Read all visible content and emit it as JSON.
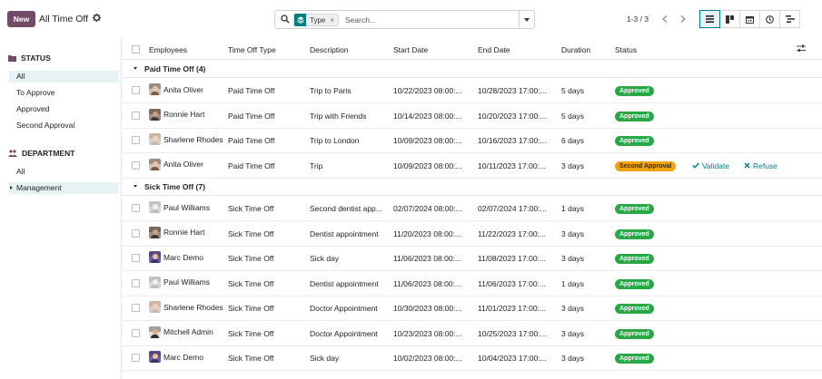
{
  "control_panel": {
    "new_label": "New",
    "title": "All Time Off",
    "search": {
      "facet_label": "Type",
      "facet_remove": "×",
      "placeholder": "Search..."
    },
    "pager": "1-3 / 3"
  },
  "sidebar": {
    "status_heading": "STATUS",
    "status_items": [
      "All",
      "To Approve",
      "Approved",
      "Second Approval"
    ],
    "department_heading": "DEPARTMENT",
    "department_items": [
      "All",
      "Management"
    ]
  },
  "table": {
    "columns": [
      "Employees",
      "Time Off Type",
      "Description",
      "Start Date",
      "End Date",
      "Duration",
      "Status"
    ],
    "groups": [
      {
        "label": "Paid Time Off (4)",
        "rows": [
          {
            "employee": "Anita Oliver",
            "type": "Paid Time Off",
            "description": "Trip to Paris",
            "start": "10/22/2023 08:00:...",
            "end": "10/28/2023 17:00:...",
            "duration": "5 days",
            "status": "Approved"
          },
          {
            "employee": "Ronnie Hart",
            "type": "Paid Time Off",
            "description": "Trip with Friends",
            "start": "10/14/2023 08:00:...",
            "end": "10/20/2023 17:00:...",
            "duration": "5 days",
            "status": "Approved"
          },
          {
            "employee": "Sharlene Rhodes",
            "type": "Paid Time Off",
            "description": "Trip to London",
            "start": "10/09/2023 08:00:...",
            "end": "10/16/2023 17:00:...",
            "duration": "6 days",
            "status": "Approved"
          },
          {
            "employee": "Anita Oliver",
            "type": "Paid Time Off",
            "description": "Trip",
            "start": "10/09/2023 08:00:...",
            "end": "10/11/2023 17:00:...",
            "duration": "3 days",
            "status": "Second Approval",
            "actions": {
              "validate": "Validate",
              "refuse": "Refuse"
            }
          }
        ]
      },
      {
        "label": "Sick Time Off (7)",
        "rows": [
          {
            "employee": "Paul Williams",
            "type": "Sick Time Off",
            "description": "Second dentist app...",
            "start": "02/07/2024 08:00:...",
            "end": "02/07/2024 17:00:...",
            "duration": "1 days",
            "status": "Approved"
          },
          {
            "employee": "Ronnie Hart",
            "type": "Sick Time Off",
            "description": "Dentist appointment",
            "start": "11/20/2023 08:00:...",
            "end": "11/22/2023 17:00:...",
            "duration": "3 days",
            "status": "Approved"
          },
          {
            "employee": "Marc Demo",
            "type": "Sick Time Off",
            "description": "Sick day",
            "start": "11/06/2023 08:00:...",
            "end": "11/08/2023 17:00:...",
            "duration": "3 days",
            "status": "Approved"
          },
          {
            "employee": "Paul Williams",
            "type": "Sick Time Off",
            "description": "Dentist appointment",
            "start": "11/06/2023 08:00:...",
            "end": "11/06/2023 17:00:...",
            "duration": "1 days",
            "status": "Approved"
          },
          {
            "employee": "Sharlene Rhodes",
            "type": "Sick Time Off",
            "description": "Doctor Appointment",
            "start": "10/30/2023 08:00:...",
            "end": "11/01/2023 17:00:...",
            "duration": "3 days",
            "status": "Approved"
          },
          {
            "employee": "Mitchell Admin",
            "type": "Sick Time Off",
            "description": "Doctor Appointment",
            "start": "10/23/2023 08:00:...",
            "end": "10/25/2023 17:00:...",
            "duration": "3 days",
            "status": "Approved"
          },
          {
            "employee": "Marc Demo",
            "type": "Sick Time Off",
            "description": "Sick day",
            "start": "10/02/2023 08:00:...",
            "end": "10/04/2023 17:00:...",
            "duration": "3 days",
            "status": "Approved"
          }
        ]
      }
    ]
  },
  "colors": {
    "brand": "#714b67",
    "accent": "#017e84",
    "approved": "#28a745",
    "second_approval": "#f0a30a"
  },
  "icons": {
    "settings": "gear-icon",
    "search": "search-icon",
    "status": "folder-icon",
    "department": "users-icon",
    "views": [
      "list-view-icon",
      "kanban-view-icon",
      "calendar-view-icon",
      "activity-view-icon",
      "gantt-view-icon"
    ]
  }
}
